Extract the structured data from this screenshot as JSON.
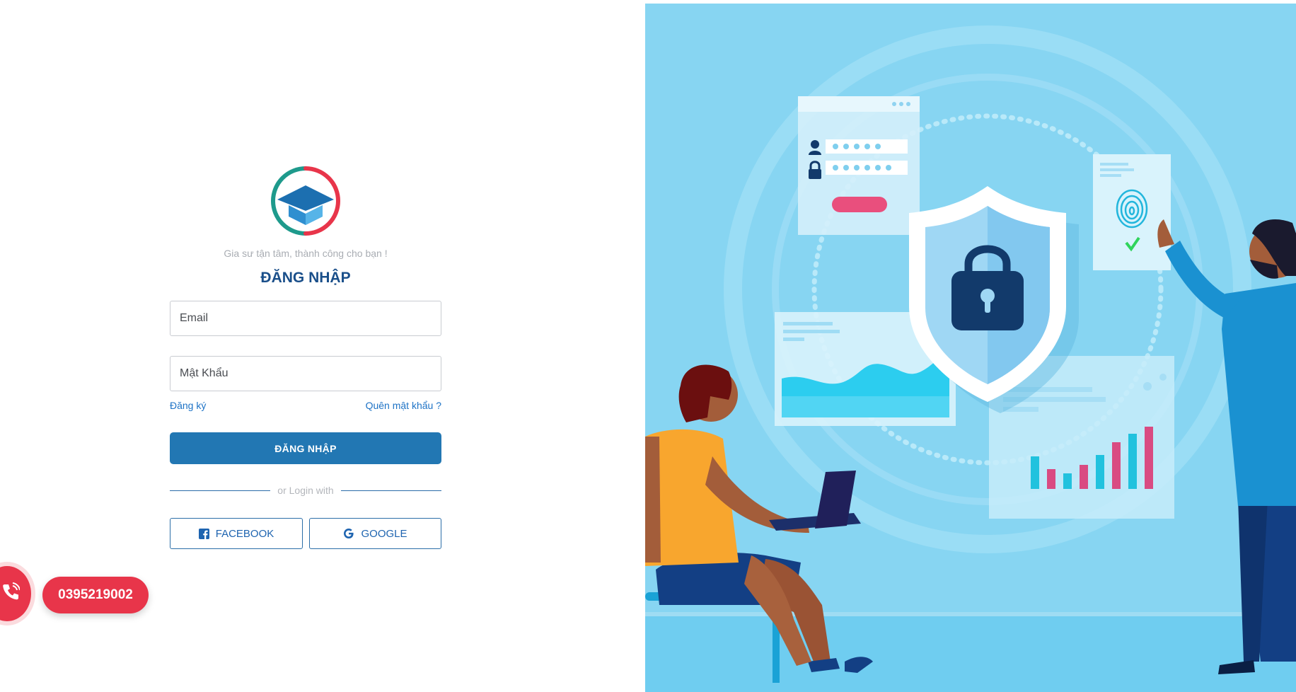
{
  "brand": {
    "tagline": "Gia sư tận tâm, thành công cho bạn !",
    "colors": {
      "primary": "#2277b3",
      "title": "#1a4f8a",
      "accent_red": "#e8354a",
      "logo_teal": "#1e9a8c"
    }
  },
  "login": {
    "title": "ĐĂNG NHẬP",
    "email_placeholder": "Email",
    "password_placeholder": "Mật Khẩu",
    "register_link": "Đăng ký",
    "forgot_link": "Quên mật khẩu ?",
    "submit_label": "ĐĂNG NHẬP",
    "divider_text": "or Login with",
    "facebook_label": "FACEBOOK",
    "google_label": "GOOGLE"
  },
  "contact": {
    "phone": "0395219002",
    "icon": "phone-icon"
  },
  "illustration": {
    "subject": "security-login-illustration",
    "icons": [
      "shield-icon",
      "padlock-icon",
      "fingerprint-icon",
      "checkmark-icon",
      "user-icon",
      "lock-icon"
    ]
  }
}
